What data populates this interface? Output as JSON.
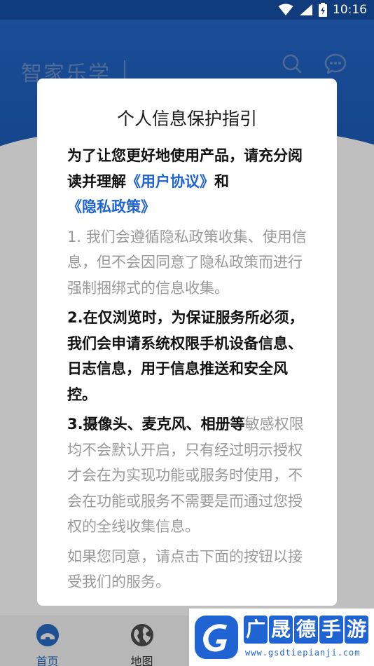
{
  "status_bar": {
    "time": "10:16"
  },
  "header": {
    "app_title": "智家乐学"
  },
  "dialog": {
    "title": "个人信息保护指引",
    "intro_prefix": "为了让您更好地使用产品，请充分阅读并理解",
    "user_agreement_link": "《用户协议》",
    "intro_and": "和",
    "privacy_policy_link": "《隐私政策》",
    "item1": "1. 我们会遵循隐私政策收集、使用信息，但不会因同意了隐私政策而进行强制捆绑式的信息收集。",
    "item2": "2.在仅浏览时，为保证服务所必须，我们会申请系统权限手机设备信息、日志信息，用于信息推送和安全风控。",
    "item3_bold": "3.摄像头、麦克风、相册等",
    "item3_rest": "敏感权限均不会默认开启，只有经过明示授权才会在为实现功能或服务时使用，不会在功能或服务不需要是而通过您授权的全线收集信息。",
    "item4": "如果您同意，请点击下面的按钮以接受我们的服务。"
  },
  "bottom_nav": {
    "items": [
      {
        "label": "首页"
      },
      {
        "label": "地图"
      }
    ]
  },
  "watermark": {
    "brand_chars": [
      "广",
      "晟",
      "德",
      "手",
      "游"
    ],
    "url": "www.gsdtiepianji.com"
  },
  "colors": {
    "header_blue": "#1a4d96",
    "status_bar": "#103c7e",
    "link_blue": "#1f64d2",
    "overlay_gray": "#bfbfbf"
  }
}
